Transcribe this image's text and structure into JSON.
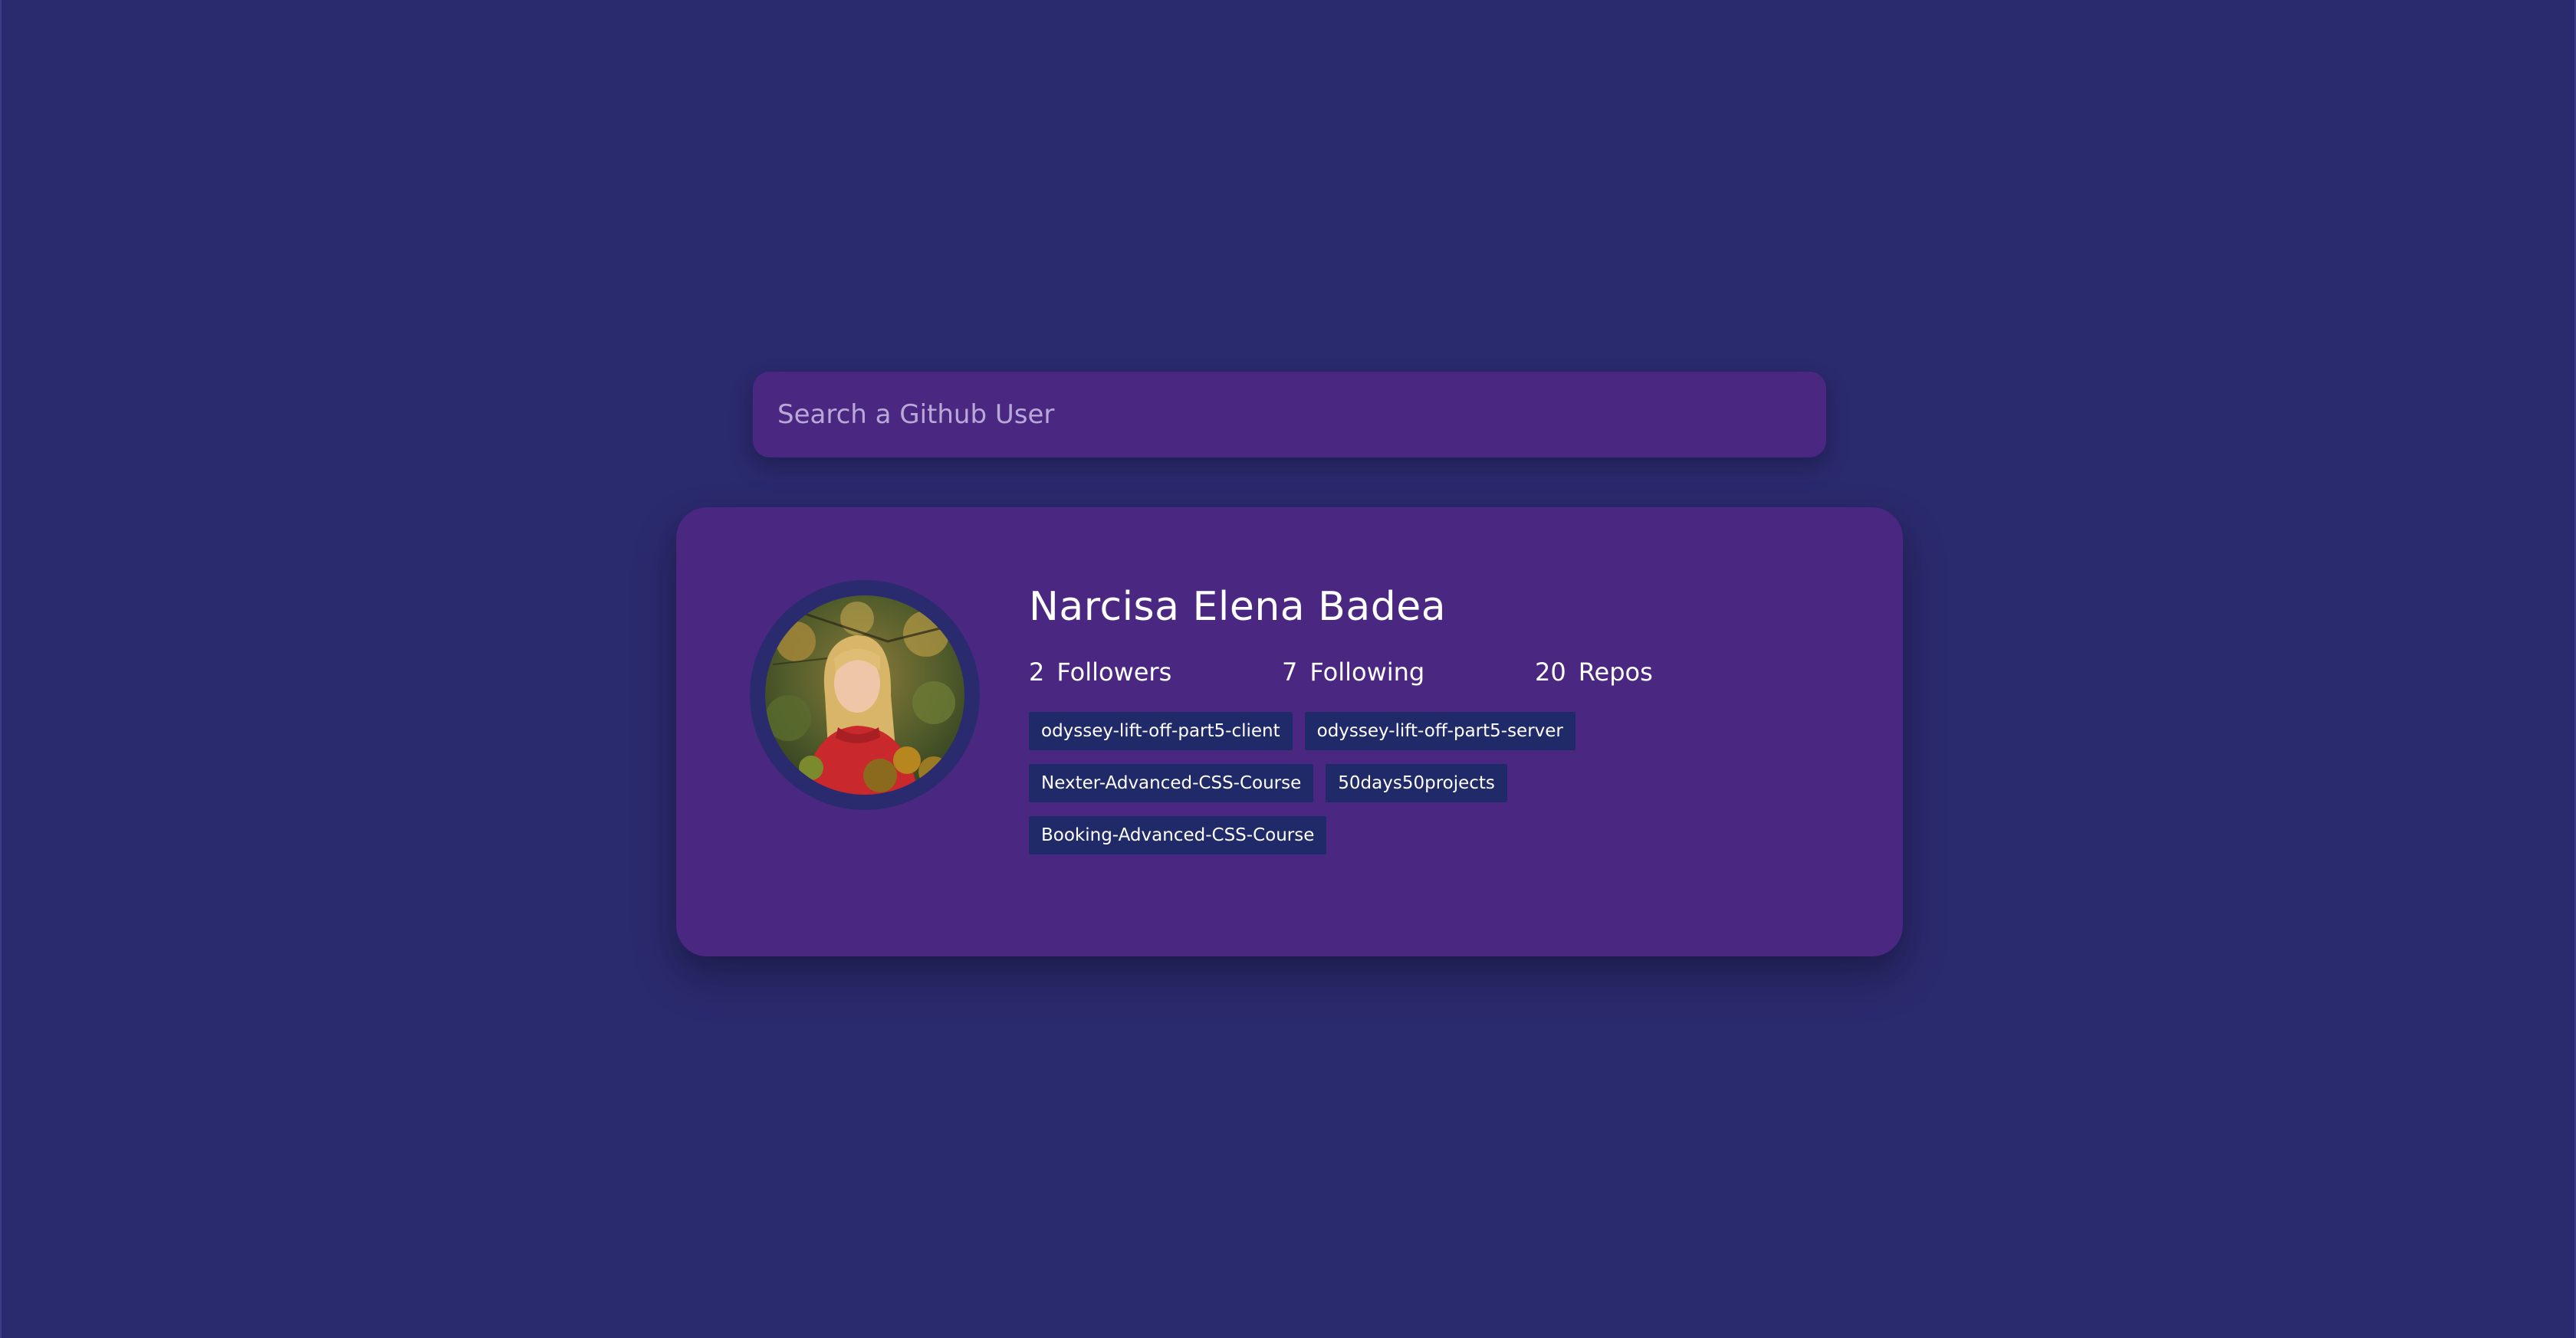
{
  "search": {
    "placeholder": "Search a Github User",
    "value": ""
  },
  "profile": {
    "name": "Narcisa Elena Badea",
    "avatar_icon": "user-avatar-photo",
    "stats": {
      "followers": {
        "count": "2",
        "label": "Followers"
      },
      "following": {
        "count": "7",
        "label": "Following"
      },
      "repos": {
        "count": "20",
        "label": "Repos"
      }
    },
    "repos": [
      "odyssey-lift-off-part5-client",
      "odyssey-lift-off-part5-server",
      "Nexter-Advanced-CSS-Course",
      "50days50projects",
      "Booking-Advanced-CSS-Course"
    ]
  },
  "colors": {
    "background": "#2a2a6e",
    "card": "#4a2781",
    "repo_tag": "#212a68",
    "text": "#ffffff",
    "placeholder": "#b9a8d8"
  }
}
